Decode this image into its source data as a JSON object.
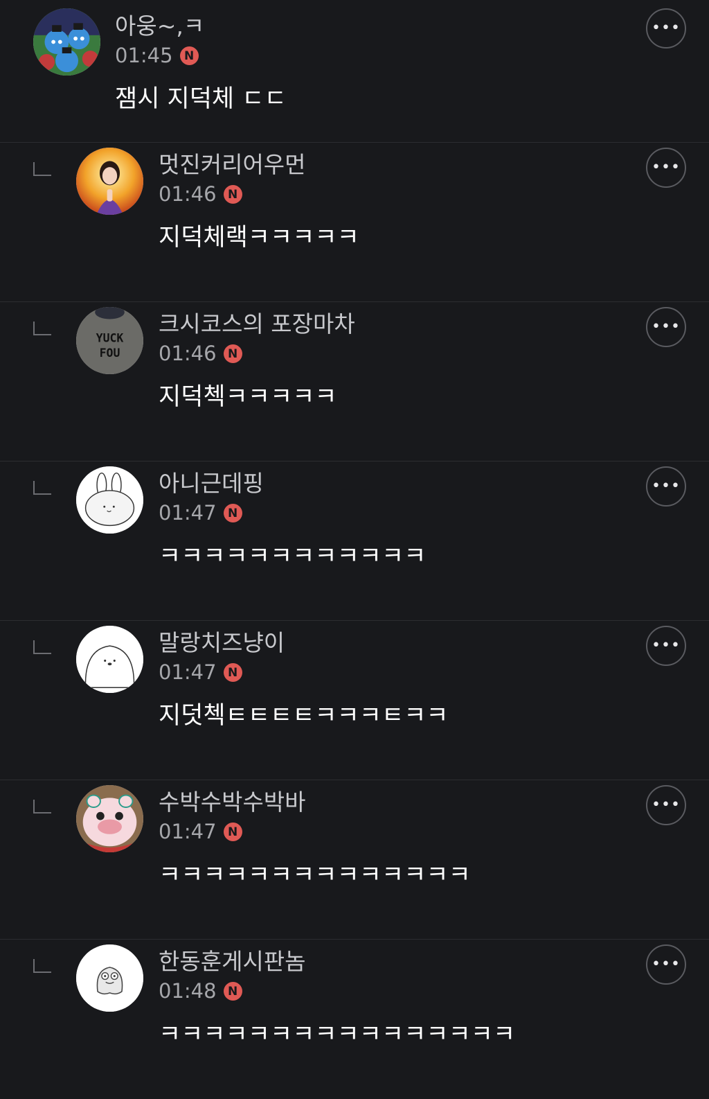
{
  "comments": [
    {
      "author": "아웅~,ㅋ",
      "time": "01:45",
      "badge": "N",
      "text": "잼시 지덕체 ㄷㄷ",
      "reply": false
    },
    {
      "author": "멋진커리어우먼",
      "time": "01:46",
      "badge": "N",
      "text": "지덕체랙ㅋㅋㅋㅋㅋ",
      "reply": true
    },
    {
      "author": "크시코스의 포장마차",
      "time": "01:46",
      "badge": "N",
      "text": "지덕첵ㅋㅋㅋㅋㅋ",
      "reply": true
    },
    {
      "author": "아니근데핑",
      "time": "01:47",
      "badge": "N",
      "text": "ㅋㅋㅋㅋㅋㅋㅋㅋㅋㅋㅋㅋ",
      "reply": true
    },
    {
      "author": "말랑치즈냥이",
      "time": "01:47",
      "badge": "N",
      "text": "지덧첵ㅌㅌㅌㅌㅋㅋㅋㅌㅋㅋ",
      "reply": true
    },
    {
      "author": "수박수박수박바",
      "time": "01:47",
      "badge": "N",
      "text": "ㅋㅋㅋㅋㅋㅋㅋㅋㅋㅋㅋㅋㅋㅋ",
      "reply": true
    },
    {
      "author": "한동훈게시판놈",
      "time": "01:48",
      "badge": "N",
      "text": "ㅋㅋㅋㅋㅋㅋㅋㅋㅋㅋㅋㅋㅋㅋㅋㅋ",
      "reply": true
    }
  ],
  "avatars": {
    "0": {
      "text": ""
    },
    "2": {
      "line1": "YUCK",
      "line2": "FOU"
    }
  },
  "more_icon": "more-horizontal-icon",
  "colors": {
    "background": "#18191c",
    "badge": "#e05a55",
    "divider": "#2c2d31"
  }
}
